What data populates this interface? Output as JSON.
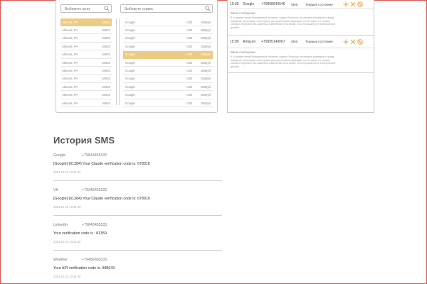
{
  "selectors": {
    "city_placeholder": "Выберите штат",
    "service_placeholder": "Выберите сервис"
  },
  "cities": [
    {
      "name": "Altoona, PA",
      "code": "16601",
      "selected": true
    },
    {
      "name": "Altoona, PA",
      "code": "16601"
    },
    {
      "name": "Altoona, PA",
      "code": "16601"
    },
    {
      "name": "Altoona, PA",
      "code": "16601"
    },
    {
      "name": "Altoona, PA",
      "code": "16601"
    },
    {
      "name": "Altoona, PA",
      "code": "16601"
    },
    {
      "name": "Altoona, PA",
      "code": "16601"
    },
    {
      "name": "Altoona, PA",
      "code": "16601"
    },
    {
      "name": "Altoona, PA",
      "code": "16601"
    },
    {
      "name": "Altoona, PA",
      "code": "16601"
    },
    {
      "name": "Altoona, PA",
      "code": "16601"
    }
  ],
  "services": [
    {
      "name": "Google",
      "count": "+130",
      "price": "150руб"
    },
    {
      "name": "Google",
      "count": "+130",
      "price": "150руб"
    },
    {
      "name": "Google",
      "count": "+130",
      "price": "150руб"
    },
    {
      "name": "Google",
      "count": "+130",
      "price": "150руб"
    },
    {
      "name": "Google",
      "count": "+130",
      "price": "150руб",
      "selected": true
    },
    {
      "name": "Google",
      "count": "+130",
      "price": "150руб"
    },
    {
      "name": "Google",
      "count": "+130",
      "price": "150руб"
    },
    {
      "name": "Google",
      "count": "+130",
      "price": "150руб"
    },
    {
      "name": "Google",
      "count": "+130",
      "price": "150руб"
    },
    {
      "name": "Google",
      "count": "+130",
      "price": "150руб"
    },
    {
      "name": "Google",
      "count": "+130",
      "price": "150руб"
    }
  ],
  "messages": [
    {
      "time": "15:00",
      "service": "Google",
      "number": "+79858640546",
      "type": "SMS",
      "state": "Текущее состояние",
      "label": "Ваше сообщение",
      "text": "В то время некий безымянный печатник создал большую коллекцию размеров и форм шрифтов, используя Lorem Ipsum для распечатки образцов. Lorem Ipsum не только успешно пережил без заметных изменений пять веков, но и перешагнул в электронный дизайн."
    },
    {
      "time": "15:00",
      "service": "Amazon",
      "number": "+79995149067",
      "type": "SMS",
      "state": "Текущее состояние",
      "label": "Ваше сообщение",
      "text": "В то время некий безымянный печатник создал большую коллекцию размеров и форм шрифтов, используя Lorem Ipsum для распечатки образцов. Lorem Ipsum не только успешно пережил без заметных изменений пять веков, но и перешагнул в электронный дизайн."
    }
  ],
  "history": {
    "title": "История SMS",
    "items": [
      {
        "service": "Google",
        "number": "+79643455331",
        "message": "[Google] (61384) Your Claude verification code is: 678910",
        "date": "2023.10.25 13:31:36"
      },
      {
        "service": "VK",
        "number": "+79345455331",
        "message": "[Google] (61384) Your Claude verification code is: 678910",
        "date": "2023.10.25 13:31:36"
      },
      {
        "service": "LinkedIn",
        "number": "+79643455331",
        "message": "Your verification code is : 81359",
        "date": "2023.10.25 13:31:36"
      },
      {
        "service": "Weather",
        "number": "+79456683331",
        "message": "Your API verification code is: 988643",
        "date": "2023.10.25 13:31:36"
      }
    ]
  },
  "icons": {
    "add": "plus-icon",
    "close": "close-icon",
    "block": "block-icon",
    "search": "search-icon"
  },
  "colors": {
    "accent": "#eccb82",
    "icon_orange": "#e8a03a",
    "frame": "#d9534f"
  }
}
